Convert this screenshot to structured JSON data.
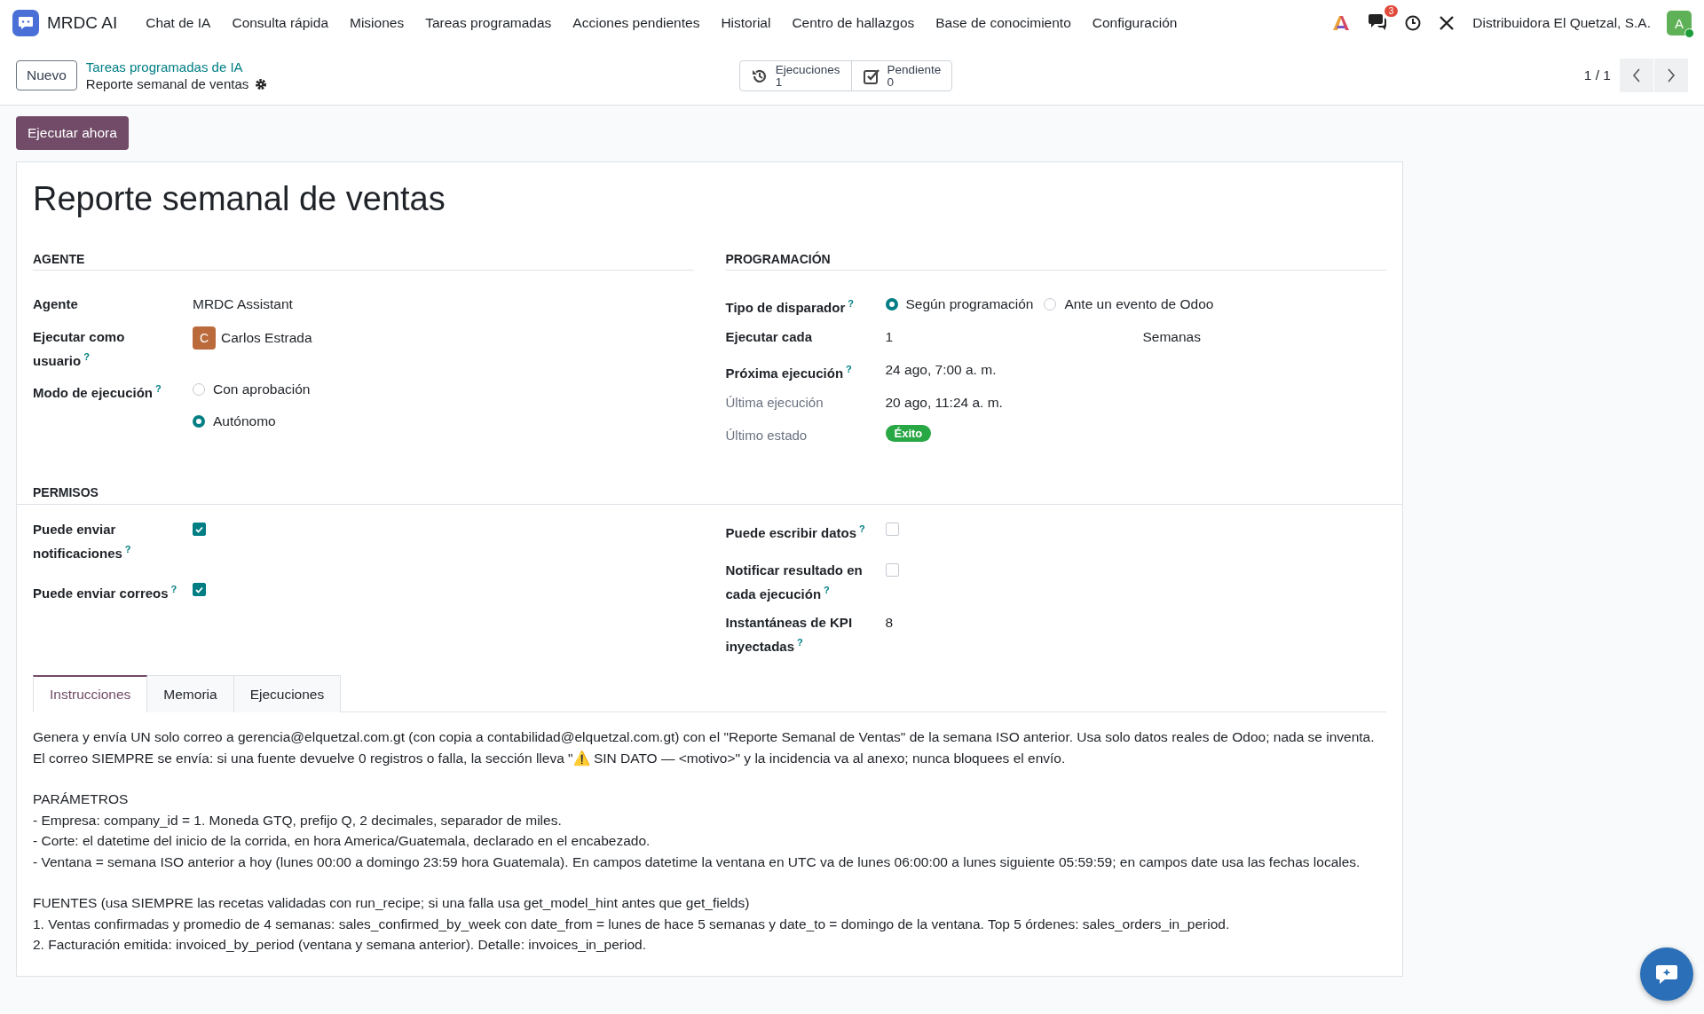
{
  "navbar": {
    "app_name": "MRDC AI",
    "menu": [
      "Chat de IA",
      "Consulta rápida",
      "Misiones",
      "Tareas programadas",
      "Acciones pendientes",
      "Historial",
      "Centro de hallazgos",
      "Base de conocimiento",
      "Configuración"
    ],
    "chat_badge": "3",
    "company": "Distribuidora El Quetzal, S.A.",
    "avatar_initial": "A"
  },
  "control_panel": {
    "new_button": "Nuevo",
    "breadcrumb": "Tareas programadas de IA",
    "current": "Reporte semanal de ventas",
    "stat_buttons": [
      {
        "kind": "history",
        "label": "Ejecuciones",
        "value": "1"
      },
      {
        "kind": "check",
        "label": "Pendiente",
        "value": "0"
      }
    ],
    "pager": "1 / 1"
  },
  "action_button": "Ejecutar ahora",
  "form": {
    "title": "Reporte semanal de ventas",
    "sections": [
      {
        "columns": [
          {
            "heading": "AGENTE",
            "fields": [
              {
                "label": "Agente",
                "kind": "text",
                "value": "MRDC Assistant"
              },
              {
                "label": "Ejecutar como usuario",
                "help": "?",
                "kind": "user",
                "initial": "C",
                "value": "Carlos Estrada"
              },
              {
                "label": "Modo de ejecución",
                "help": "?",
                "kind": "radio_stack",
                "options": [
                  {
                    "label": "Con aprobación",
                    "selected": false
                  },
                  {
                    "label": "Autónomo",
                    "selected": true
                  }
                ]
              }
            ]
          },
          {
            "heading": "PROGRAMACIÓN",
            "fields": [
              {
                "label": "Tipo de disparador",
                "help": "?",
                "kind": "radio_inline",
                "options": [
                  {
                    "label": "Según programación",
                    "selected": true
                  },
                  {
                    "label": "Ante un evento de Odoo",
                    "selected": false
                  }
                ]
              },
              {
                "label": "Ejecutar cada",
                "kind": "interval",
                "value": "1",
                "unit": "Semanas"
              },
              {
                "label": "Próxima ejecución",
                "help": "?",
                "kind": "text",
                "value": "24 ago, 7:00 a. m."
              },
              {
                "label": "Última ejecución",
                "muted": true,
                "kind": "text",
                "value": "20 ago, 11:24 a. m."
              },
              {
                "label": "Último estado",
                "muted": true,
                "kind": "badge",
                "value": "Éxito",
                "color": "#28a745"
              }
            ]
          }
        ]
      },
      {
        "heading": "PERMISOS",
        "columns": [
          {
            "fields": [
              {
                "label": "Puede enviar notificaciones",
                "help": "?",
                "kind": "checkbox",
                "checked": true
              },
              {
                "label": "Puede enviar correos",
                "help": "?",
                "kind": "checkbox",
                "checked": true
              }
            ]
          },
          {
            "fields": [
              {
                "label": "Puede escribir datos",
                "help": "?",
                "kind": "checkbox",
                "checked": false
              },
              {
                "label": "Notificar resultado en cada ejecución",
                "help": "?",
                "kind": "checkbox",
                "checked": false
              },
              {
                "label": "Instantáneas de KPI inyectadas",
                "help": "?",
                "kind": "text",
                "value": "8"
              }
            ]
          }
        ]
      }
    ],
    "tabs": [
      {
        "label": "Instrucciones",
        "selected": true
      },
      {
        "label": "Memoria",
        "selected": false
      },
      {
        "label": "Ejecuciones",
        "selected": false
      }
    ],
    "instructions": [
      [
        "Genera y envía UN solo correo a gerencia@elquetzal.com.gt (con copia a contabilidad@elquetzal.com.gt) con el \"Reporte Semanal de Ventas\" de la semana ISO anterior. Usa solo datos reales de Odoo; nada se inventa. El correo SIEMPRE se envía: si una fuente devuelve 0 registros o falla, la sección lleva \"⚠️ SIN DATO — <motivo>\" y la incidencia va al anexo; nunca bloquees el envío."
      ],
      [
        "PARÁMETROS",
        "- Empresa: company_id = 1. Moneda GTQ, prefijo Q, 2 decimales, separador de miles.",
        "- Corte: el datetime del inicio de la corrida, en hora America/Guatemala, declarado en el encabezado.",
        "- Ventana = semana ISO anterior a hoy (lunes 00:00 a domingo 23:59 hora Guatemala). En campos datetime la ventana en UTC va de lunes 06:00:00 a lunes siguiente 05:59:59; en campos date usa las fechas locales."
      ],
      [
        "FUENTES (usa SIEMPRE las recetas validadas con run_recipe; si una falla usa get_model_hint antes que get_fields)",
        "1. Ventas confirmadas y promedio de 4 semanas: sales_confirmed_by_week con date_from = lunes de hace 5 semanas y date_to = domingo de la ventana. Top 5 órdenes: sales_orders_in_period.",
        "2. Facturación emitida: invoiced_by_period (ventana y semana anterior). Detalle: invoices_in_period."
      ]
    ]
  }
}
